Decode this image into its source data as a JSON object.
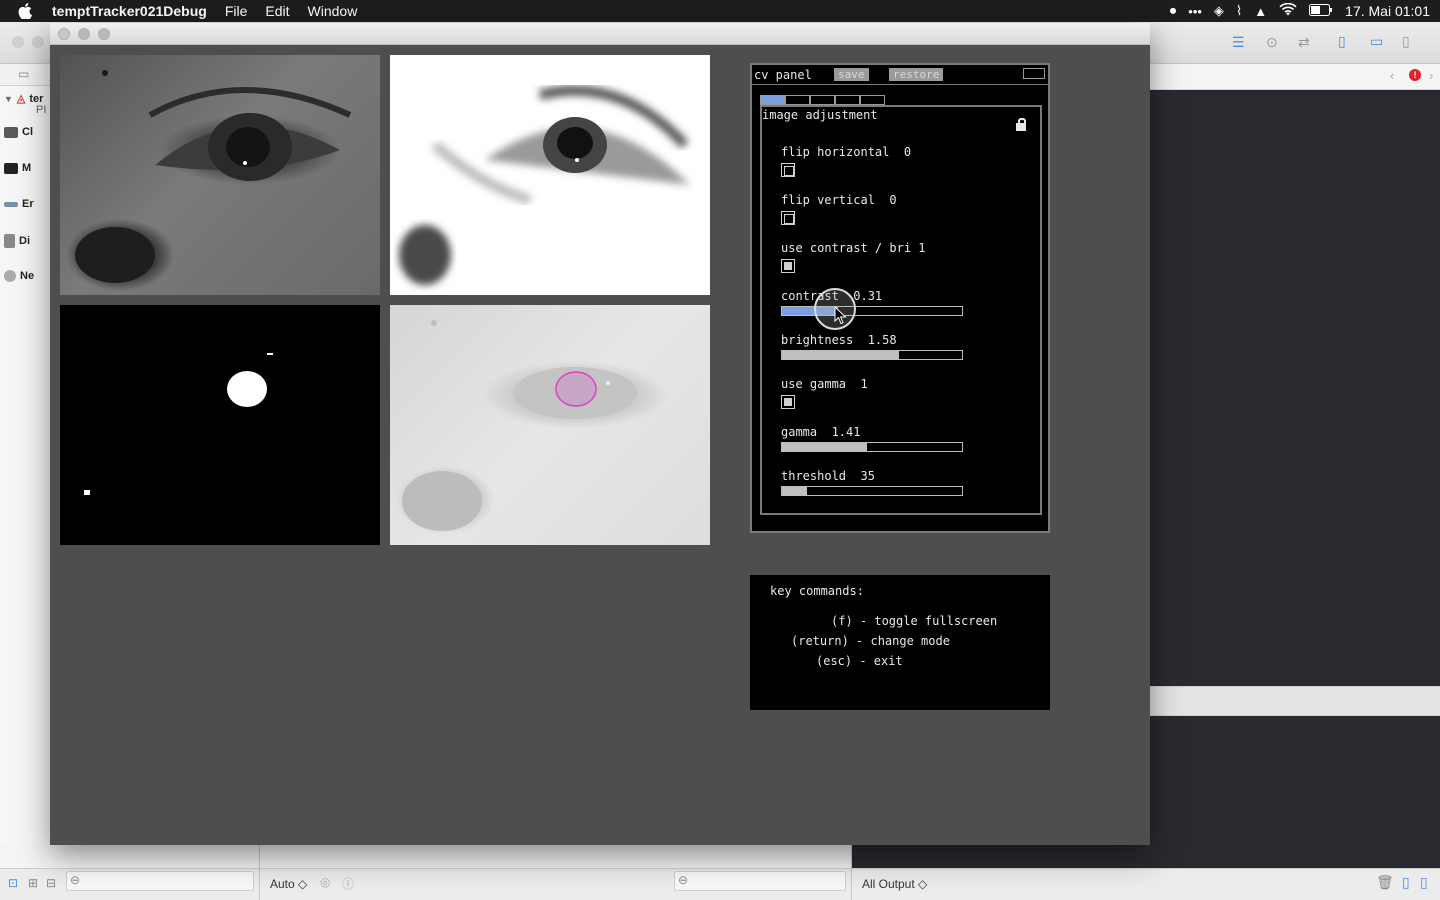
{
  "menubar": {
    "app_name": "temptTracker021Debug",
    "menus": [
      "File",
      "Edit",
      "Window"
    ],
    "clock": "17. Mai  01:01"
  },
  "xcode": {
    "nav_items": [
      "ter",
      "PI",
      "Cl",
      "M",
      "Er",
      "Di",
      "Ne"
    ],
    "scheme_selector": "Auto ◇",
    "console_selector": "All Output ◇"
  },
  "views": {
    "top_left": "grayscale camera image",
    "top_right": "thresholded contrast image",
    "bottom_left": "binary blob image",
    "bottom_right": "tracked pupil overlay"
  },
  "cv_panel": {
    "title": "cv panel",
    "save_label": "save",
    "restore_label": "restore",
    "group_title": "image adjustment",
    "tabs": [
      true,
      false,
      false,
      false,
      false
    ],
    "controls": {
      "flip_horizontal": {
        "label": "flip horizontal  0",
        "value": 0
      },
      "flip_vertical": {
        "label": "flip vertical  0",
        "value": 0
      },
      "use_contrast": {
        "label": "use contrast / bri 1",
        "value": 1
      },
      "contrast": {
        "label": "contrast  0.31",
        "value": 0.31,
        "fraction": 0.31
      },
      "brightness": {
        "label": "brightness  1.58",
        "value": 1.58,
        "fraction": 0.65
      },
      "use_gamma": {
        "label": "use gamma  1",
        "value": 1
      },
      "gamma": {
        "label": "gamma  1.41",
        "value": 1.41,
        "fraction": 0.47
      },
      "threshold": {
        "label": "threshold  35",
        "value": 35,
        "fraction": 0.14
      }
    }
  },
  "key_commands": {
    "title": "key commands:",
    "lines": [
      "(f) - toggle fullscreen",
      "(return) - change mode",
      "(esc) - exit"
    ]
  },
  "colors": {
    "accent": "#7b9fe0",
    "pupil_circle": "#e040c0",
    "window_bg": "#4e4e4e"
  }
}
